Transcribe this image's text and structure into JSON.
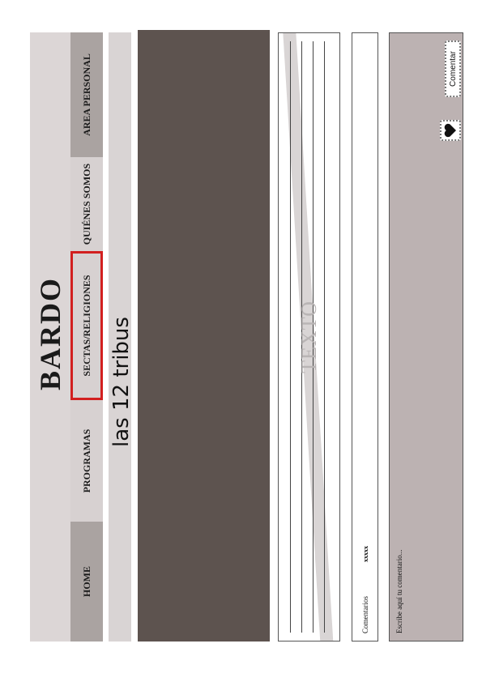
{
  "header": {
    "site_title": "BARDO"
  },
  "nav": {
    "items": [
      {
        "label": "HOME"
      },
      {
        "label": "PROGRAMAS"
      },
      {
        "label": "SECTAS/RELIGIONES"
      },
      {
        "label": "QUIÉNES SOMOS"
      },
      {
        "label": "AREA PERSONAL"
      }
    ],
    "active_index": 2
  },
  "page": {
    "subtitle": "las 12 tribus"
  },
  "content": {
    "text_placeholder": "TEXTO"
  },
  "comments": {
    "label": "Comentarios",
    "count": "xxxxx",
    "input_placeholder": "Escribe aquí tu comentario...",
    "submit_label": "Comentar",
    "like_icon": "heart-icon"
  },
  "colors": {
    "header_bg": "#dcd6d6",
    "nav_dark": "#aaa3a1",
    "nav_light": "#d7d1d1",
    "active_border": "#d21f1f",
    "hero_bg": "#5d534f",
    "comment_box_bg": "#bcb2b2"
  }
}
